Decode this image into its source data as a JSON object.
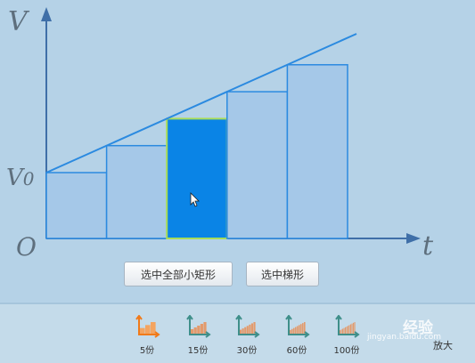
{
  "graph": {
    "y_axis_label": "V",
    "start_label": "V",
    "start_label_sub": "0",
    "origin_label": "O",
    "x_axis_label": "t",
    "rectangle_count": 5,
    "selected_rectangle": 3,
    "colors": {
      "background": "#b5d2e7",
      "axis": "#3f6fa8",
      "line": "#2b8ae0",
      "rect_fill": "#a5c8e8",
      "selected_fill": "#0a84e6",
      "selected_border": "#a8dc5a"
    }
  },
  "buttons": {
    "select_all_rects": "选中全部小矩形",
    "select_trapezoid": "选中梯形"
  },
  "toolbar": {
    "items": [
      {
        "label": "5份",
        "icon": "graph-5-icon",
        "active": true
      },
      {
        "label": "15份",
        "icon": "graph-15-icon",
        "active": false
      },
      {
        "label": "30份",
        "icon": "graph-30-icon",
        "active": false
      },
      {
        "label": "60份",
        "icon": "graph-60-icon",
        "active": false
      },
      {
        "label": "100份",
        "icon": "graph-100-icon",
        "active": false
      }
    ]
  },
  "watermark": {
    "text": "经验",
    "url": "jingyan.baidu.com",
    "zoom": "放大"
  }
}
